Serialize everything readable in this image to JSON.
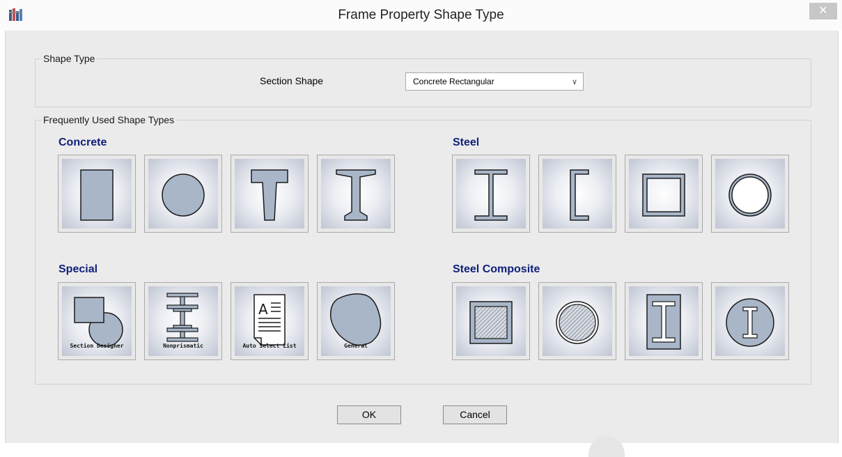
{
  "window": {
    "title": "Frame Property Shape Type",
    "app_icon": "etabs-app-icon",
    "close_label": "✕"
  },
  "shape_type": {
    "legend": "Shape Type",
    "section_shape_label": "Section Shape",
    "section_shape_value": "Concrete Rectangular"
  },
  "frequent": {
    "legend": "Frequently Used Shape Types",
    "groups": {
      "concrete": {
        "title": "Concrete",
        "tiles": [
          "concrete-rectangular-icon",
          "concrete-circle-icon",
          "concrete-tee-icon",
          "concrete-precast-i-icon"
        ]
      },
      "steel": {
        "title": "Steel",
        "tiles": [
          "steel-i-wide-flange-icon",
          "steel-channel-icon",
          "steel-tube-icon",
          "steel-pipe-icon"
        ]
      },
      "special": {
        "title": "Special",
        "captions": [
          "Section Designer",
          "Nonprismatic",
          "Auto Select List",
          "General"
        ]
      },
      "steel_composite": {
        "title": "Steel Composite",
        "tiles": [
          "filled-tube-icon",
          "filled-pipe-icon",
          "encased-rectangle-icon",
          "encased-circle-icon"
        ]
      }
    }
  },
  "buttons": {
    "ok": "OK",
    "cancel": "Cancel"
  },
  "colors": {
    "shape_fill": "#a8b6c8",
    "shape_stroke": "#1a1a1a",
    "group_title": "#10207a"
  }
}
